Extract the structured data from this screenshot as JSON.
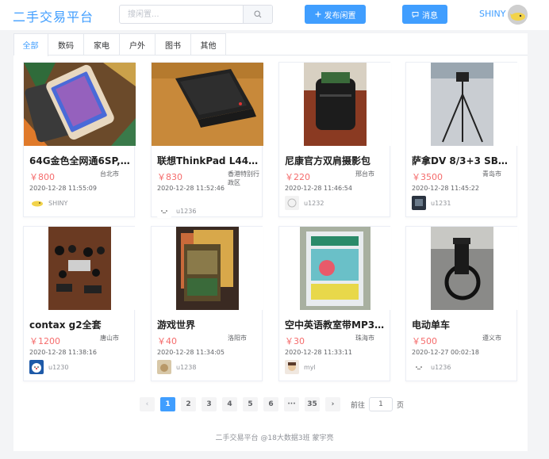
{
  "header": {
    "logo": "二手交易平台",
    "search_placeholder": "搜闲置...",
    "publish_label": "发布闲置",
    "messages_label": "消息",
    "username": "SHINY"
  },
  "tabs": [
    "全部",
    "数码",
    "家电",
    "户外",
    "图书",
    "其他"
  ],
  "active_tab": "全部",
  "items": [
    {
      "title": "64G金色全网通6SP,…",
      "price": "￥800",
      "city": "台北市",
      "time": "2020-12-28 11:55:09",
      "seller": "SHINY"
    },
    {
      "title": "联想ThinkPad L440…",
      "price": "￥830",
      "city": "香港特别行政区",
      "time": "2020-12-28 11:52:46",
      "seller": "u1236"
    },
    {
      "title": "尼康官方双肩摄影包",
      "price": "￥220",
      "city": "邢台市",
      "time": "2020-12-28 11:46:54",
      "seller": "u1232"
    },
    {
      "title": "萨拿DV 8/3+3 SB液…",
      "price": "￥3500",
      "city": "青岛市",
      "time": "2020-12-28 11:45:22",
      "seller": "u1231"
    },
    {
      "title": "contax g2全套",
      "price": "￥1200",
      "city": "唐山市",
      "time": "2020-12-28 11:38:16",
      "seller": "u1230"
    },
    {
      "title": "游戏世界",
      "price": "￥40",
      "city": "洛阳市",
      "time": "2020-12-28 11:34:05",
      "seller": "u1238"
    },
    {
      "title": "空中英语教室带MP3…",
      "price": "￥30",
      "city": "珠海市",
      "time": "2020-12-28 11:33:11",
      "seller": "myl"
    },
    {
      "title": "电动单车",
      "price": "￥500",
      "city": "遵义市",
      "time": "2020-12-27 00:02:18",
      "seller": "u1236"
    }
  ],
  "pagination": {
    "prev": "‹",
    "pages": [
      "1",
      "2",
      "3",
      "4",
      "5",
      "6",
      "···",
      "35"
    ],
    "current": "1",
    "next": "›",
    "goto_prefix": "前往",
    "goto_value": "1",
    "goto_suffix": "页"
  },
  "footer": "二手交易平台 @18大数据3班 蒙宇亮",
  "colors": {
    "accent": "#409eff",
    "price": "#f56c6c",
    "background": "#f3f4f6"
  },
  "icons": {
    "search": "search-icon",
    "publish": "plus-icon",
    "messages": "chat-icon"
  }
}
